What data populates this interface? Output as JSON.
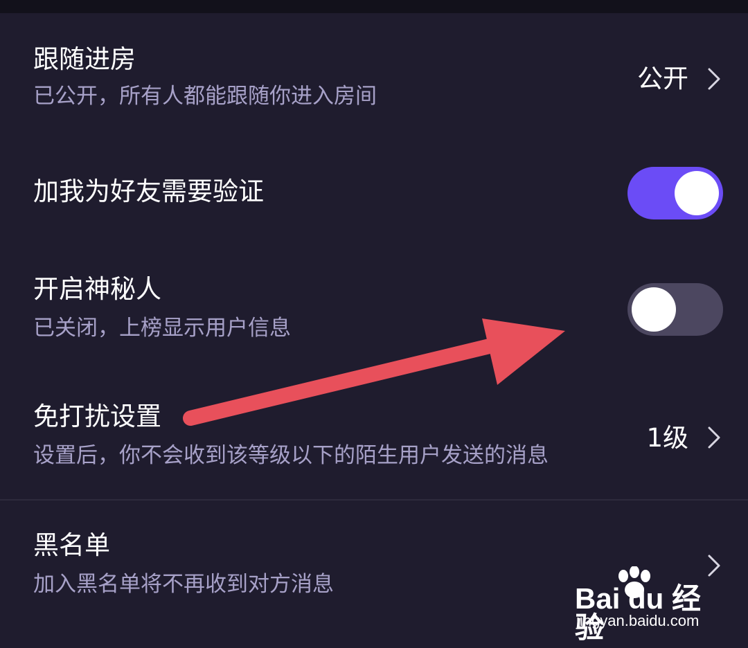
{
  "settings": {
    "follow_room": {
      "title": "跟随进房",
      "subtitle": "已公开，所有人都能跟随你进入房间",
      "value": "公开"
    },
    "friend_verify": {
      "title": "加我为好友需要验证",
      "toggle_state": "on"
    },
    "mystery_person": {
      "title": "开启神秘人",
      "subtitle": "已关闭，上榜显示用户信息",
      "toggle_state": "off"
    },
    "do_not_disturb": {
      "title": "免打扰设置",
      "subtitle": "设置后，你不会收到该等级以下的陌生用户发送的消息",
      "value": "1级"
    },
    "blacklist": {
      "title": "黑名单",
      "subtitle": "加入黑名单将不再收到对方消息"
    }
  },
  "colors": {
    "background": "#1f1c2e",
    "toggle_on": "#6b4cf6",
    "toggle_off": "#4c4760",
    "subtitle_text": "#a7a1c8",
    "annotation_arrow": "#e8505b"
  },
  "watermark": {
    "logo": "Bai du 经验",
    "url": "jingyan.baidu.com"
  }
}
